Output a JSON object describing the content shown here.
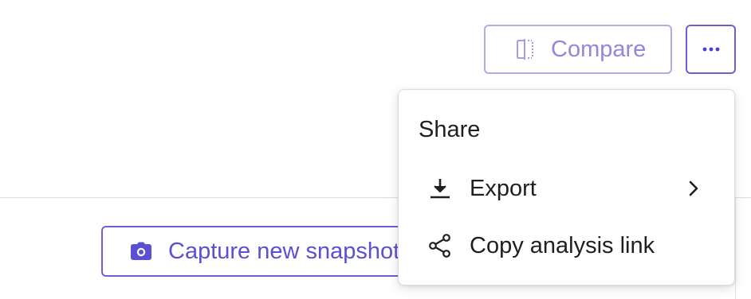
{
  "toolbar": {
    "compare_label": "Compare",
    "compare_icon": "compare-split-icon",
    "more_icon": "ellipsis-icon"
  },
  "snapshot": {
    "capture_label": "Capture new snapshot",
    "capture_icon": "camera-icon"
  },
  "menu": {
    "heading": "Share",
    "items": [
      {
        "label": "Export",
        "icon": "download-icon",
        "has_submenu": true
      },
      {
        "label": "Copy analysis link",
        "icon": "share-icon",
        "has_submenu": false
      }
    ]
  },
  "colors": {
    "accent": "#5b4fd2",
    "accent_disabled": "#8f88dc",
    "text": "#1f1f1f"
  }
}
